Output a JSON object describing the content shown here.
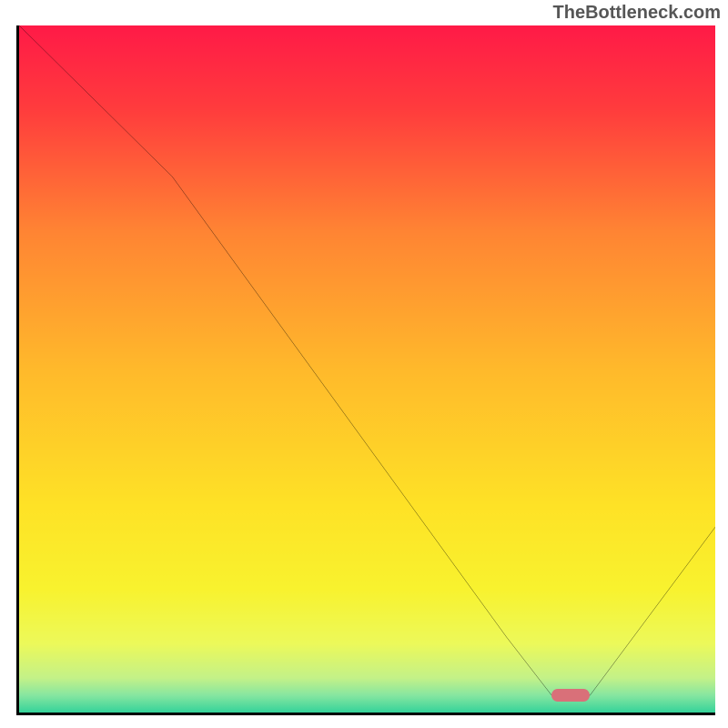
{
  "attribution": "TheBottleneck.com",
  "chart_data": {
    "type": "line",
    "title": "",
    "xlabel": "",
    "ylabel": "",
    "xlim": [
      0,
      100
    ],
    "ylim": [
      0,
      100
    ],
    "grid": false,
    "legend": false,
    "gradient_stops": [
      {
        "offset": 0,
        "color": "#ff1a47"
      },
      {
        "offset": 0.12,
        "color": "#ff3b3d"
      },
      {
        "offset": 0.3,
        "color": "#ff8433"
      },
      {
        "offset": 0.5,
        "color": "#ffb92b"
      },
      {
        "offset": 0.7,
        "color": "#fee226"
      },
      {
        "offset": 0.82,
        "color": "#f8f22e"
      },
      {
        "offset": 0.9,
        "color": "#ecf95a"
      },
      {
        "offset": 0.95,
        "color": "#c3f188"
      },
      {
        "offset": 0.975,
        "color": "#86e6a0"
      },
      {
        "offset": 1.0,
        "color": "#35d39a"
      }
    ],
    "series": [
      {
        "name": "bottleneck-curve",
        "x": [
          0,
          22,
          70,
          76.5,
          82,
          100
        ],
        "y": [
          100,
          78,
          11,
          2.5,
          2.5,
          27
        ]
      }
    ],
    "marker": {
      "x_start": 76.5,
      "x_end": 82,
      "y": 2.5,
      "color": "#d97079"
    }
  }
}
